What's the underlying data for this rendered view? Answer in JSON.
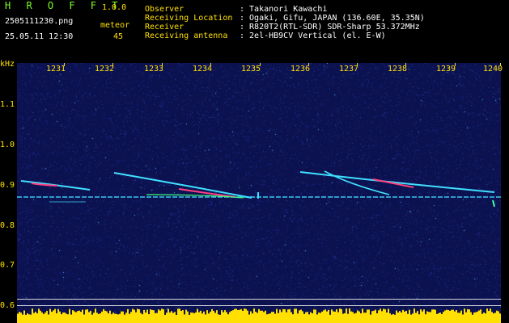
{
  "brand": {
    "name": "H R O F F T",
    "version": "1.0.0"
  },
  "file": {
    "name": "2505111230.png",
    "datetime": "25.05.11 12:30"
  },
  "counter": {
    "label": "meteor",
    "value": "45"
  },
  "info": [
    {
      "label": "Observer",
      "value": ": Takanori Kawachi"
    },
    {
      "label": "Receiving Location",
      "value": ": Ogaki, Gifu, JAPAN (136.60E, 35.35N)"
    },
    {
      "label": "Receiver",
      "value": ": R820T2(RTL-SDR) SDR-Sharp 53.372MHz"
    },
    {
      "label": "Receiving antenna",
      "value": ": 2el-HB9CV Vertical (el. E-W)"
    }
  ],
  "axis": {
    "unit": "kHz",
    "y_ticks": [
      "1.1",
      "1.0",
      "0.9",
      "0.8",
      "0.7",
      "0.6"
    ],
    "x_ticks": [
      "1231",
      "1232",
      "1233",
      "1234",
      "1235",
      "1236",
      "1237",
      "1238",
      "1239",
      "1240"
    ]
  },
  "colors": {
    "background": "#000000",
    "plot_background": "#0c1250",
    "header_green": "#7cff2a",
    "header_white": "#ffffff",
    "axis_yellow": "#ffe000",
    "trace_cyan": "#40e0ff",
    "trace_hot": "#ff4080",
    "level_bar": "#ffe000"
  }
}
